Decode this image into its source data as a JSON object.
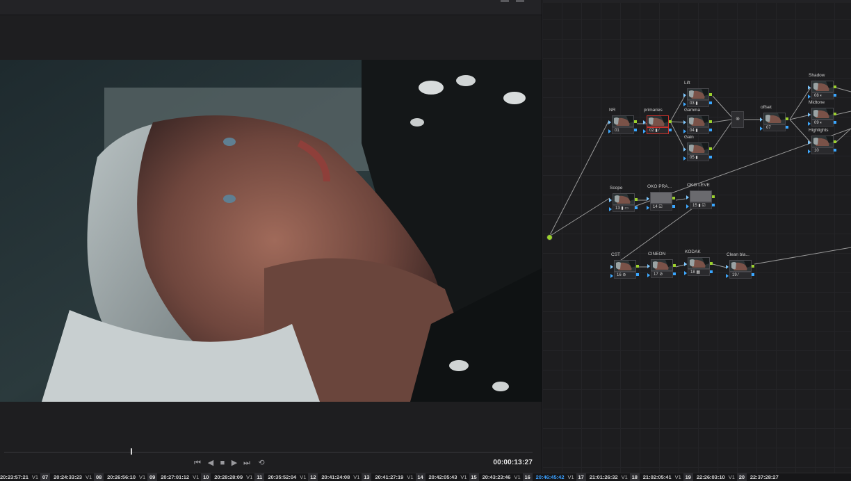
{
  "viewer": {
    "timecode": "00:00:13:27",
    "playhead_progress": 0.24,
    "transport": {
      "go_to_start": "⏮",
      "prev_frame": "◀",
      "stop": "■",
      "play": "▶",
      "go_to_end": "⏭",
      "loop": "⟲"
    }
  },
  "node_graph": {
    "nodes": [
      {
        "id": "01",
        "label": "NR",
        "icons": ""
      },
      {
        "id": "02",
        "label": "primaries",
        "icons": "▮ ⁄"
      },
      {
        "id": "03",
        "label": "Lift",
        "icons": "▮"
      },
      {
        "id": "04",
        "label": "Gamma",
        "icons": "▮"
      },
      {
        "id": "05",
        "label": "Gain",
        "icons": "▮"
      },
      {
        "id": "07",
        "label": "offset",
        "icons": ""
      },
      {
        "id": "08",
        "label": "Shadow",
        "icons": "◐"
      },
      {
        "id": "09",
        "label": "Midtone",
        "icons": "◐"
      },
      {
        "id": "10",
        "label": "Highlights",
        "icons": ""
      },
      {
        "id": "13",
        "label": "Scope",
        "icons": "▮ ▭"
      },
      {
        "id": "14",
        "label": "OKO PRA...",
        "icons": "☑"
      },
      {
        "id": "15",
        "label": "OKO LEVE",
        "icons": "▮ ☑"
      },
      {
        "id": "16",
        "label": "CST",
        "icons": "⊘"
      },
      {
        "id": "17",
        "label": "CINEON",
        "icons": "⊘"
      },
      {
        "id": "18",
        "label": "KODAK",
        "icons": "▦"
      },
      {
        "id": "19",
        "label": "Clean bla...",
        "icons": "⁄"
      }
    ],
    "mixer_symbol": "⊗"
  },
  "clips": [
    {
      "tc": "20:23:57:21",
      "track": "V1",
      "num": "07"
    },
    {
      "tc": "20:24:33:23",
      "track": "V1",
      "num": "08"
    },
    {
      "tc": "20:26:56:10",
      "track": "V1",
      "num": "09"
    },
    {
      "tc": "20:27:01:12",
      "track": "V1",
      "num": "10"
    },
    {
      "tc": "20:28:28:09",
      "track": "V1",
      "num": "11"
    },
    {
      "tc": "20:35:52:04",
      "track": "V1",
      "num": "12"
    },
    {
      "tc": "20:41:24:08",
      "track": "V1",
      "num": "13"
    },
    {
      "tc": "20:41:27:19",
      "track": "V1",
      "num": "14"
    },
    {
      "tc": "20:42:05:43",
      "track": "V1",
      "num": "15"
    },
    {
      "tc": "20:43:23:46",
      "track": "V1",
      "num": "16"
    },
    {
      "tc": "20:46:45:42",
      "track": "V1",
      "num": "17"
    },
    {
      "tc": "21:01:26:32",
      "track": "V1",
      "num": "18"
    },
    {
      "tc": "21:02:05:41",
      "track": "V1",
      "num": "19"
    },
    {
      "tc": "22:26:03:10",
      "track": "V1",
      "num": "20"
    },
    {
      "tc": "22:37:28:27",
      "track": "",
      "num": ""
    }
  ],
  "colors": {
    "active_clip_timecode": "#3aa0ff",
    "selected_node_border": "#c8322c",
    "output_green": "#9bd12d",
    "output_blue": "#39a6ff"
  }
}
